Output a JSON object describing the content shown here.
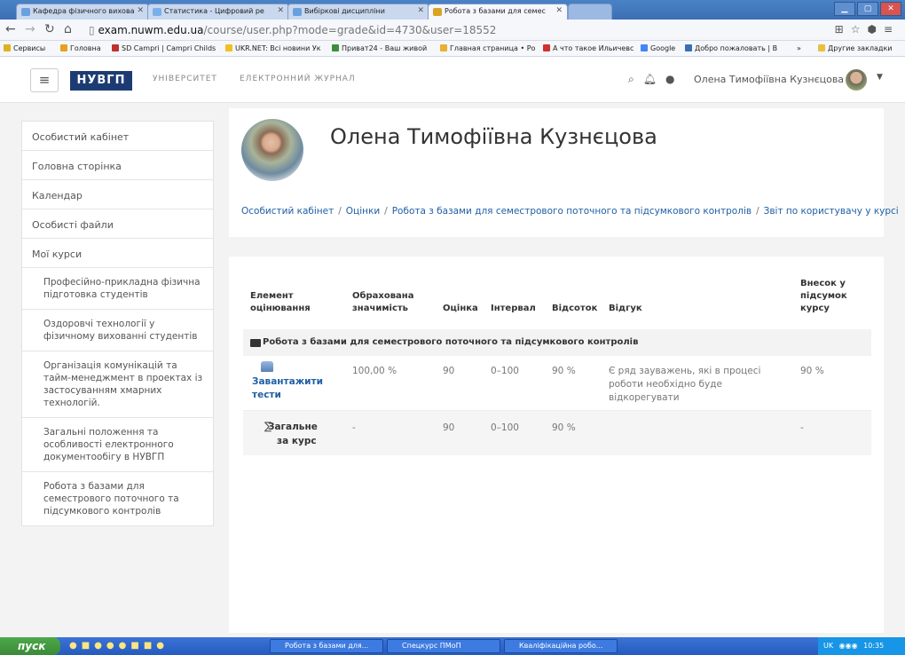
{
  "browser": {
    "tabs": [
      {
        "label": "Кафедра фізичного вихова",
        "color": "#6aa0e0"
      },
      {
        "label": "Статистика - Цифровий ре",
        "color": "#7ab0ea"
      },
      {
        "label": "Вибіркові дисципліни",
        "color": "#6aa0e0"
      },
      {
        "label": "Робота з базами для семес",
        "color": "#d9a326"
      }
    ],
    "url_host": "exam.nuwm.edu.ua",
    "url_path": "/course/user.php?mode=grade&id=4730&user=18552",
    "bookmarks": [
      {
        "label": "Сервисы",
        "color": "#e0b020"
      },
      {
        "label": "Головна",
        "color": "#e8a020"
      },
      {
        "label": "SD Campri | Campri Childs",
        "color": "#c03030"
      },
      {
        "label": "UKR.NET: Всі новини Ук",
        "color": "#f0c020"
      },
      {
        "label": "Приват24 - Ваш живой",
        "color": "#3b8f3b"
      },
      {
        "label": "Главная страница • Ро",
        "color": "#e8b030"
      },
      {
        "label": "А что такое Ильичевс",
        "color": "#d03030"
      },
      {
        "label": "Google",
        "color": "#4285f4"
      },
      {
        "label": "Добро пожаловать | В",
        "color": "#3a6fb0"
      },
      {
        "label": "»",
        "color": ""
      },
      {
        "label": "Другие закладки",
        "color": "#e8c040"
      }
    ]
  },
  "header": {
    "logo": "НУВГП",
    "brand1": "УНІВЕРСИТЕТ",
    "brand2": "ЕЛЕКТРОННИЙ ЖУРНАЛ",
    "user_name": "Олена Тимофіївна Кузнєцова"
  },
  "sidebar": {
    "items": [
      "Особистий кабінет",
      "Головна сторінка",
      "Календар",
      "Особисті файли",
      "Мої курси"
    ],
    "courses": [
      "Професійно-прикладна фізична підготовка студентів",
      "Оздоровчі технології у фізичному вихованні студентів",
      "Організація комунікацій та тайм-менеджмент в проектах із застосуванням хмарних технологій.",
      "Загальні положення та особливості електронного документообігу в НУВГП",
      "Робота з базами для семестрового поточного та підсумкового контролів"
    ]
  },
  "profile": {
    "name": "Олена Тимофіївна Кузнєцова",
    "breadcrumb": [
      "Особистий кабінет",
      "Оцінки",
      "Робота з базами для семестрового поточного та підсумкового контролів",
      "Звіт по користувачу у курсі"
    ]
  },
  "grades": {
    "headers": {
      "item": "Елемент оцінювання",
      "weight": "Обрахована значимість",
      "grade": "Оцінка",
      "range": "Інтервал",
      "percent": "Відсоток",
      "feedback": "Відгук",
      "contrib": "Внесок у підсумок курсу"
    },
    "category": "Робота з базами для семестрового поточного та підсумкового контролів",
    "item": {
      "name": "Завантажити тести",
      "weight": "100,00 %",
      "grade": "90",
      "range": "0–100",
      "percent": "90 %",
      "feedback": "Є ряд зауважень, які в процесі роботи необхідно буде відкорегувати",
      "contrib": "90 %"
    },
    "total": {
      "name": "Загальне за курс",
      "weight": "-",
      "grade": "90",
      "range": "0–100",
      "percent": "90 %",
      "contrib": "-"
    }
  },
  "taskbar": {
    "start": "пуск",
    "tasks": [
      "Робота з базами для...",
      "Спецкурс ПМоП",
      "Кваліфікаційна робо..."
    ],
    "tray": "UK",
    "clock": "10:35"
  }
}
